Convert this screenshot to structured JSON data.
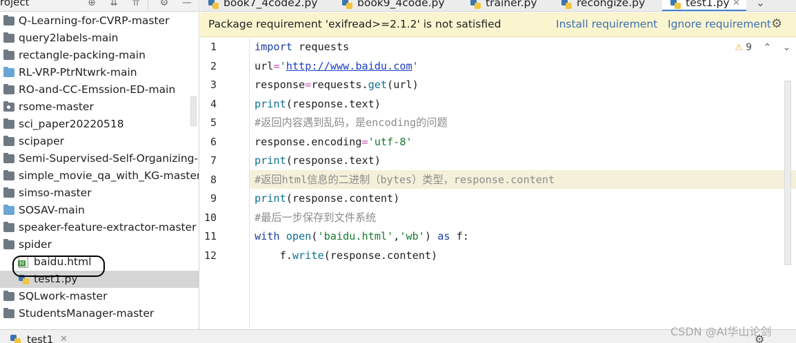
{
  "project": {
    "title": "roject",
    "tree": [
      {
        "label": "Q-Learning-for-CVRP-master",
        "icon": "folder-icon"
      },
      {
        "label": "query2labels-main",
        "icon": "folder-icon"
      },
      {
        "label": "rectangle-packing-main",
        "icon": "folder-icon"
      },
      {
        "label": "RL-VRP-PtrNtwrk-main",
        "icon": "source-folder-icon"
      },
      {
        "label": "RO-and-CC-Emssion-ED-main",
        "icon": "folder-icon"
      },
      {
        "label": "rsome-master",
        "icon": "package-folder-icon"
      },
      {
        "label": "sci_paper20220518",
        "icon": "folder-icon"
      },
      {
        "label": "scipaper",
        "icon": "folder-icon"
      },
      {
        "label": "Semi-Supervised-Self-Organizing-Fu",
        "icon": "folder-icon"
      },
      {
        "label": "simple_movie_qa_with_KG-master",
        "icon": "folder-icon"
      },
      {
        "label": "simso-master",
        "icon": "folder-icon"
      },
      {
        "label": "SOSAV-main",
        "icon": "source-folder-icon"
      },
      {
        "label": "speaker-feature-extractor-master",
        "icon": "folder-icon"
      },
      {
        "label": "spider",
        "icon": "folder-icon"
      },
      {
        "label": "baidu.html",
        "icon": "html-file-icon"
      },
      {
        "label": "test1.py",
        "icon": "python-file-icon"
      },
      {
        "label": "SQLwork-master",
        "icon": "folder-icon"
      },
      {
        "label": "StudentsManager-master",
        "icon": "folder-icon"
      }
    ]
  },
  "tabs": [
    {
      "label": "book7_4code2.py",
      "active": false
    },
    {
      "label": "book9_4code.py",
      "active": false
    },
    {
      "label": "trainer.py",
      "active": false
    },
    {
      "label": "recongize.py",
      "active": false
    },
    {
      "label": "test1.py",
      "active": true
    }
  ],
  "banner": {
    "message": "Package requirement 'exifread>=2.1.2' is not satisfied",
    "install_label": "Install requirement",
    "ignore_label": "Ignore requirement"
  },
  "editor": {
    "line_numbers": [
      "1",
      "2",
      "3",
      "4",
      "5",
      "6",
      "7",
      "8",
      "9",
      "10",
      "11",
      "12"
    ],
    "current_line": 8,
    "warning_count": "9",
    "lines": [
      [
        {
          "t": "import",
          "c": "kw"
        },
        {
          "t": " requests",
          "c": ""
        }
      ],
      [
        {
          "t": "url",
          "c": ""
        },
        {
          "t": "=",
          "c": "op"
        },
        {
          "t": "'",
          "c": "str"
        },
        {
          "t": "http://www.baidu.com",
          "c": "url"
        },
        {
          "t": "'",
          "c": "str"
        }
      ],
      [
        {
          "t": "response",
          "c": ""
        },
        {
          "t": "=",
          "c": "op"
        },
        {
          "t": "requests.",
          "c": ""
        },
        {
          "t": "get",
          "c": "fn"
        },
        {
          "t": "(url)",
          "c": ""
        }
      ],
      [
        {
          "t": "print",
          "c": "fn"
        },
        {
          "t": "(response.text)",
          "c": ""
        }
      ],
      [
        {
          "t": "#返回内容遇到乱码，是encoding的问题",
          "c": "cm"
        }
      ],
      [
        {
          "t": "response.encoding",
          "c": ""
        },
        {
          "t": "=",
          "c": "op"
        },
        {
          "t": "'utf-8'",
          "c": "str"
        }
      ],
      [
        {
          "t": "print",
          "c": "fn"
        },
        {
          "t": "(response.text)",
          "c": ""
        }
      ],
      [
        {
          "t": "#返回html信息的二进制（bytes）类型，response.content",
          "c": "cm"
        }
      ],
      [
        {
          "t": "print",
          "c": "fn"
        },
        {
          "t": "(response.content)",
          "c": ""
        }
      ],
      [
        {
          "t": "#最后一步保存到文件系统",
          "c": "cm"
        }
      ],
      [
        {
          "t": "with ",
          "c": "kw"
        },
        {
          "t": "open",
          "c": "fn"
        },
        {
          "t": "(",
          "c": ""
        },
        {
          "t": "'baidu.html'",
          "c": "str"
        },
        {
          "t": ",",
          "c": ""
        },
        {
          "t": "'wb'",
          "c": "str"
        },
        {
          "t": ") ",
          "c": ""
        },
        {
          "t": "as",
          "c": "kw"
        },
        {
          "t": " f:",
          "c": ""
        }
      ],
      [
        {
          "t": "    f.",
          "c": ""
        },
        {
          "t": "write",
          "c": "fn"
        },
        {
          "t": "(response.content)",
          "c": ""
        }
      ]
    ]
  },
  "bottom": {
    "run_tab_label": "test1",
    "watermark": "CSDN @AI华山论剑"
  },
  "colors": {
    "banner_bg": "#faf4cf",
    "current_line_bg": "#f5f0d9",
    "link": "#3a6fb3",
    "keyword": "#1c3f9e",
    "string": "#157a2f",
    "comment": "#8c8c8c",
    "selection": "#d5d5d5"
  }
}
